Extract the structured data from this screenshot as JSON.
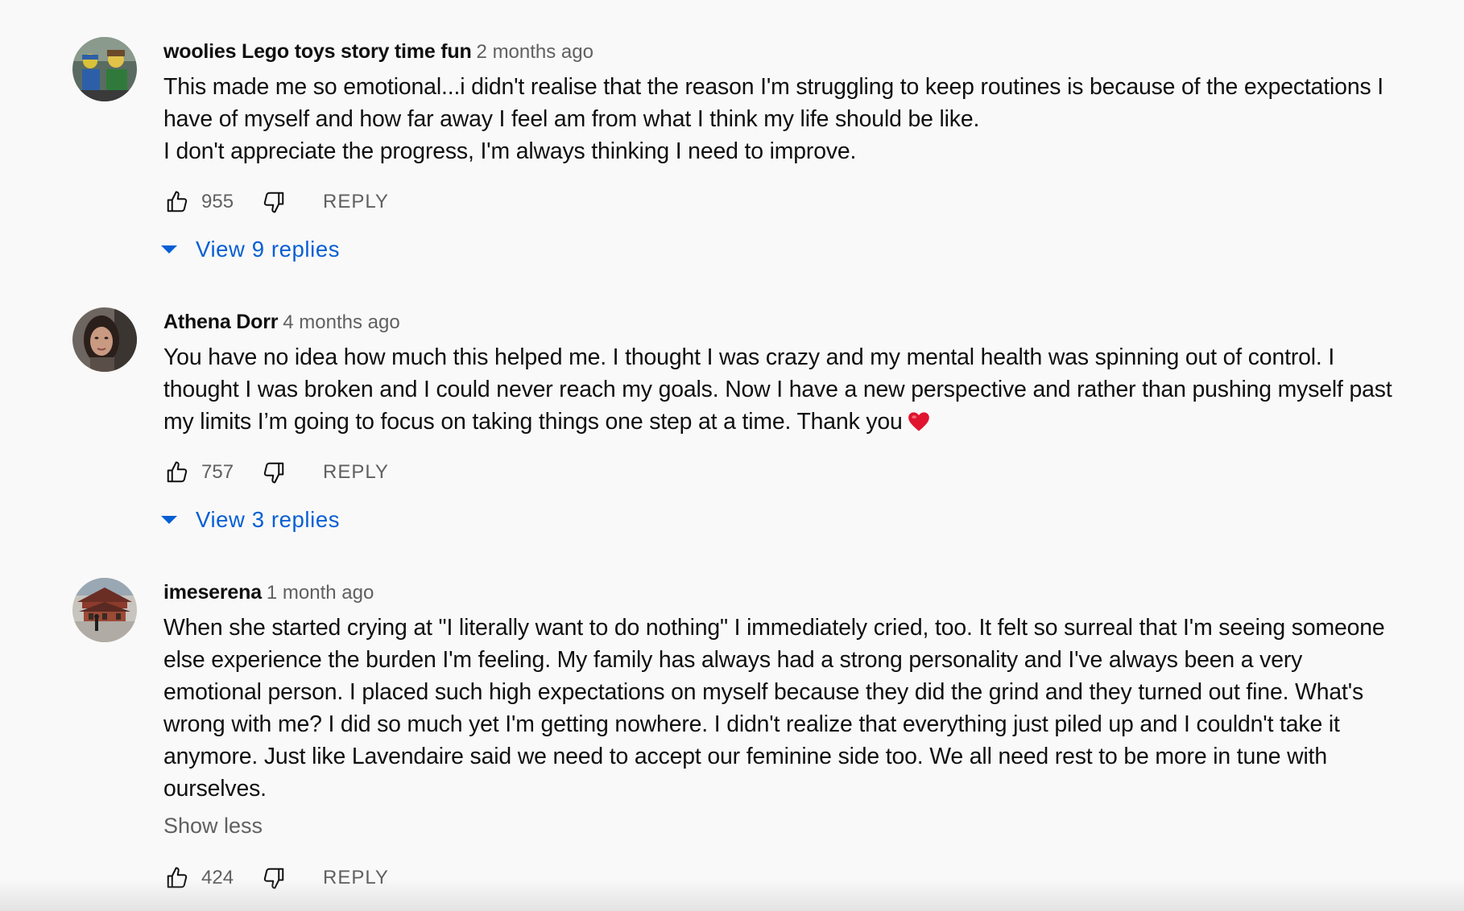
{
  "comments": [
    {
      "author": "woolies Lego toys story time fun",
      "timestamp": "2 months ago",
      "avatar_icon": "lego-figures-avatar",
      "text_lines": [
        "This made me so emotional...i didn't realise that the reason I'm struggling to keep routines is because of the expectations I",
        "have of myself and how far away I feel am from what I think my life should be like.",
        "I don't appreciate the progress, I'm always thinking I need to improve."
      ],
      "likes": "955",
      "reply_label": "REPLY",
      "view_replies": "View 9 replies"
    },
    {
      "author": "Athena Dorr",
      "timestamp": "4 months ago",
      "avatar_icon": "portrait-avatar",
      "text_lines": [
        "You have no idea how much this helped me. I thought I was crazy and my mental health was spinning out of control. I",
        "thought I was broken and I could never reach my goals. Now I have a new perspective and rather than pushing myself past",
        "my limits I’m going to focus on taking things one step at a time. Thank you"
      ],
      "likes": "757",
      "reply_label": "REPLY",
      "view_replies": "View 3 replies"
    },
    {
      "author": "imeserena",
      "timestamp": "1 month ago",
      "avatar_icon": "temple-photo-avatar",
      "text_lines": [
        "When she started crying at \"I literally want to do nothing\" I immediately cried, too. It felt so surreal that I'm seeing someone",
        "else experience the burden I'm feeling. My family has always had a strong personality and I've always been a very",
        "emotional person. I placed such high expectations on myself because they did the grind and they turned out fine. What's",
        "wrong with me? I did so much yet I'm getting nowhere. I didn't realize that everything just piled up and I couldn't take it",
        "anymore. Just like Lavendaire said we need to accept our feminine side too. We all need rest to be more in tune with",
        "ourselves."
      ],
      "show_less": "Show less",
      "likes": "424",
      "reply_label": "REPLY"
    }
  ],
  "colors": {
    "background": "#f9f9f9",
    "text_primary": "#0f0f0f",
    "text_secondary": "#606060",
    "link_blue": "#065fd4",
    "heart_red": "#e0142e"
  }
}
